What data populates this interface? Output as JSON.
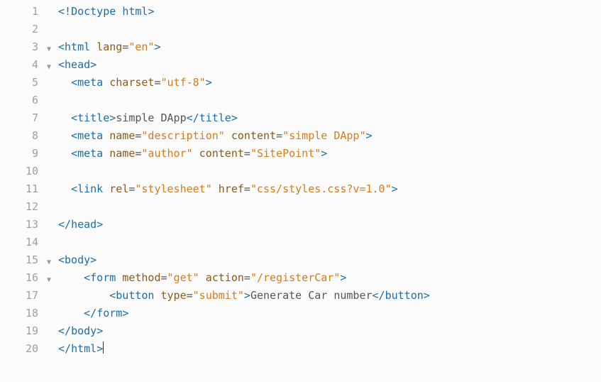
{
  "line_numbers": [
    "1",
    "2",
    "3",
    "4",
    "5",
    "6",
    "7",
    "8",
    "9",
    "10",
    "11",
    "12",
    "13",
    "14",
    "15",
    "16",
    "17",
    "18",
    "19",
    "20"
  ],
  "fold_lines": [
    3,
    4,
    15,
    16
  ],
  "fold_glyph": "▼",
  "code": {
    "l1": {
      "pre": "",
      "open": "<!",
      "name": "Doctype",
      "space": " ",
      "word": "html",
      "close": ">"
    },
    "l2": {
      "blank": " "
    },
    "l3": {
      "pre": "",
      "open": "<",
      "name": "html",
      "attrs": [
        {
          "k": "lang",
          "v": "\"en\""
        }
      ],
      "close": ">"
    },
    "l4": {
      "pre": "",
      "open": "<",
      "name": "head",
      "close": ">"
    },
    "l5": {
      "pre": "  ",
      "open": "<",
      "name": "meta",
      "attrs": [
        {
          "k": "charset",
          "v": "\"utf-8\""
        }
      ],
      "close": ">"
    },
    "l6": {
      "blank": " "
    },
    "l7": {
      "pre": "  ",
      "open": "<",
      "name": "title",
      "close": ">",
      "text": "simple DApp",
      "open2": "</",
      "name2": "title",
      "close2": ">"
    },
    "l8": {
      "pre": "  ",
      "open": "<",
      "name": "meta",
      "attrs": [
        {
          "k": "name",
          "v": "\"description\""
        },
        {
          "k": "content",
          "v": "\"simple DApp\""
        }
      ],
      "close": ">"
    },
    "l9": {
      "pre": "  ",
      "open": "<",
      "name": "meta",
      "attrs": [
        {
          "k": "name",
          "v": "\"author\""
        },
        {
          "k": "content",
          "v": "\"SitePoint\""
        }
      ],
      "close": ">"
    },
    "l10": {
      "blank": " "
    },
    "l11": {
      "pre": "  ",
      "open": "<",
      "name": "link",
      "attrs": [
        {
          "k": "rel",
          "v": "\"stylesheet\""
        },
        {
          "k": "href",
          "v": "\"css/styles.css?v=1.0\""
        }
      ],
      "close": ">"
    },
    "l12": {
      "blank": " "
    },
    "l13": {
      "pre": "",
      "open": "</",
      "name": "head",
      "close": ">"
    },
    "l14": {
      "blank": " "
    },
    "l15": {
      "pre": "",
      "open": "<",
      "name": "body",
      "close": ">"
    },
    "l16": {
      "pre": "    ",
      "open": "<",
      "name": "form",
      "attrs": [
        {
          "k": "method",
          "v": "\"get\""
        },
        {
          "k": "action",
          "v": "\"/registerCar\""
        }
      ],
      "close": ">"
    },
    "l17": {
      "pre": "        ",
      "open": "<",
      "name": "button",
      "attrs": [
        {
          "k": "type",
          "v": "\"submit\""
        }
      ],
      "close": ">",
      "text": "Generate Car number",
      "open2": "</",
      "name2": "button",
      "close2": ">"
    },
    "l18": {
      "pre": "    ",
      "open": "</",
      "name": "form",
      "close": ">"
    },
    "l19": {
      "pre": "",
      "open": "</",
      "name": "body",
      "close": ">"
    },
    "l20": {
      "pre": "",
      "open": "</",
      "name": "html",
      "close": ">",
      "cursor": true
    }
  }
}
